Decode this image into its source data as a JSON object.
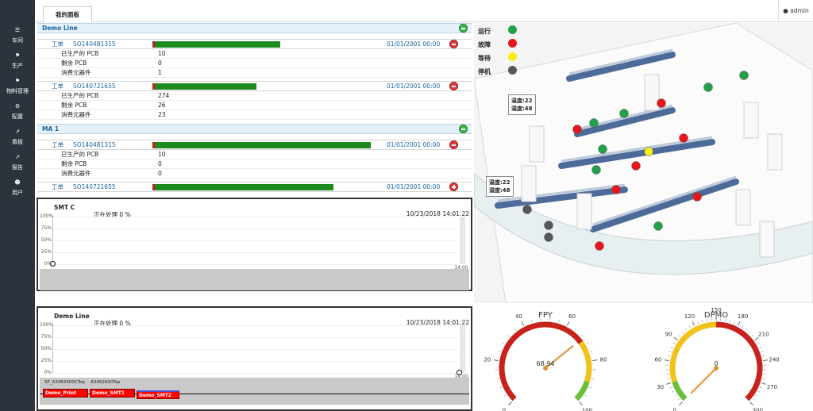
{
  "sidebar": {
    "items": [
      {
        "label": "车间",
        "icon": "sitemap-icon"
      },
      {
        "label": "生产",
        "icon": "flag-icon"
      },
      {
        "label": "物料管理",
        "icon": "flag-icon"
      },
      {
        "label": "配置",
        "icon": "gear-icon"
      },
      {
        "label": "看板",
        "icon": "line-chart-icon"
      },
      {
        "label": "报告",
        "icon": "line-chart-icon"
      },
      {
        "label": "用户",
        "icon": "users-icon"
      }
    ]
  },
  "header": {
    "tab": "我的面板",
    "user": "admin"
  },
  "groups": [
    {
      "name": "Demo Line",
      "rows": [
        {
          "label": "工单",
          "order": "SO140481315",
          "progress": 0.58,
          "date": "01/01/2001 00:00",
          "stats": [
            {
              "label": "已生产的 PCB",
              "value": "10"
            },
            {
              "label": "剩余 PCB",
              "value": "0"
            },
            {
              "label": "消费元器件",
              "value": "1"
            }
          ]
        },
        {
          "label": "工单",
          "order": "SO140721655",
          "progress": 0.47,
          "date": "01/01/2001 00:00",
          "stats": [
            {
              "label": "已生产的 PCB",
              "value": "274"
            },
            {
              "label": "剩余 PCB",
              "value": "26"
            },
            {
              "label": "消费元器件",
              "value": "23"
            }
          ]
        }
      ]
    },
    {
      "name": "MA 1",
      "rows": [
        {
          "label": "工单",
          "order": "SO140481315",
          "progress": 0.99,
          "date": "01/01/2001 00:00",
          "stats": [
            {
              "label": "已生产的 PCB",
              "value": "10"
            },
            {
              "label": "剩余 PCB",
              "value": "0"
            },
            {
              "label": "消费元器件",
              "value": "0"
            }
          ]
        },
        {
          "label": "工单",
          "order": "SO140721655",
          "progress": 0.82,
          "date": "01/01/2001 00:00"
        }
      ]
    }
  ],
  "panels": [
    {
      "title": "SMT C",
      "status": "正在处理 0 %",
      "date": "10/23/2018 14:01:22",
      "yticks": [
        "100%",
        "75%",
        "50%",
        "25%",
        "0%"
      ],
      "xlabel": "14:00"
    },
    {
      "title": "Demo Line",
      "status": "正在处理 0 %",
      "date": "10/23/2018 14:01:22",
      "yticks": [
        "100%",
        "75%",
        "50%",
        "25%",
        "0%"
      ],
      "xlabel": "14:00",
      "timeline_tags": [
        "SP_A3462600CTop",
        "A3462600Top"
      ],
      "timeline_items": [
        "Demo_Print",
        "Demo_SMT1",
        "Demo_SMT2"
      ]
    }
  ],
  "legend": [
    {
      "label": "运行",
      "color": "#22a14a"
    },
    {
      "label": "故障",
      "color": "#e8161c"
    },
    {
      "label": "等待",
      "color": "#f6ed14"
    },
    {
      "label": "停机",
      "color": "#55575a"
    }
  ],
  "sensors": [
    {
      "temp": "温度:22",
      "hum": "湿度:48"
    },
    {
      "temp": "温度:22",
      "hum": "湿度:48"
    }
  ],
  "gauges": [
    {
      "title": "FPY",
      "value": 68.94,
      "value_text": "68.94",
      "min": 0,
      "max": 100,
      "ticks": [
        "0",
        "20",
        "40",
        "60",
        "80",
        "100"
      ],
      "bands": [
        {
          "to": 0.7,
          "color": "#c7221c"
        },
        {
          "to": 0.9,
          "color": "#f1c21b"
        },
        {
          "to": 1,
          "color": "#6cbf3b"
        }
      ]
    },
    {
      "title": "DPMO",
      "value": 0,
      "value_text": "0",
      "min": 0,
      "max": 300,
      "ticks": [
        "0",
        "30",
        "60",
        "90",
        "120",
        "150",
        "180",
        "210",
        "240",
        "270",
        "300"
      ],
      "bands": [
        {
          "to": 0.1,
          "color": "#6cbf3b"
        },
        {
          "to": 0.5,
          "color": "#f1c21b"
        },
        {
          "to": 1,
          "color": "#c7221c"
        }
      ]
    }
  ]
}
